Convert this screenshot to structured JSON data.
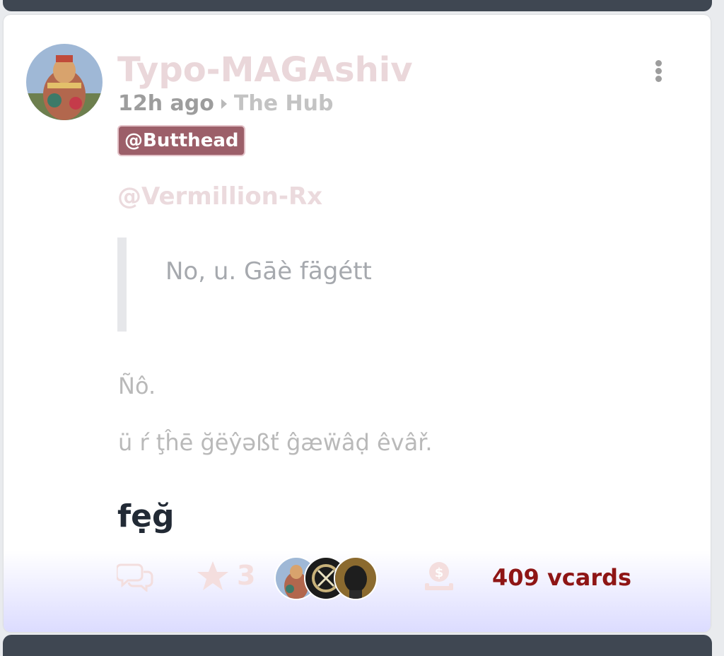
{
  "post": {
    "author": "Typo-MAGAshiv",
    "time": "12h ago",
    "community": "The Hub",
    "badge": "@Butthead",
    "mention": "@Vermillion-Rx",
    "quote": "No, u. Gāè fägétt",
    "paragraphs": [
      "Ñô.",
      "ü ŕ ţĥē ğëŷəßť ĝæẅâḍ êvâř."
    ],
    "headline": "fẹğ"
  },
  "actions": {
    "comment_icon": "comment-icon",
    "star_icon": "star-icon",
    "star_count": "3",
    "coin_icon": "coin-icon",
    "vcards_label": "409 vcards"
  },
  "colors": {
    "badge_bg": "#9c5f69",
    "vcards": "#8e1515",
    "username": "#ead7da"
  }
}
